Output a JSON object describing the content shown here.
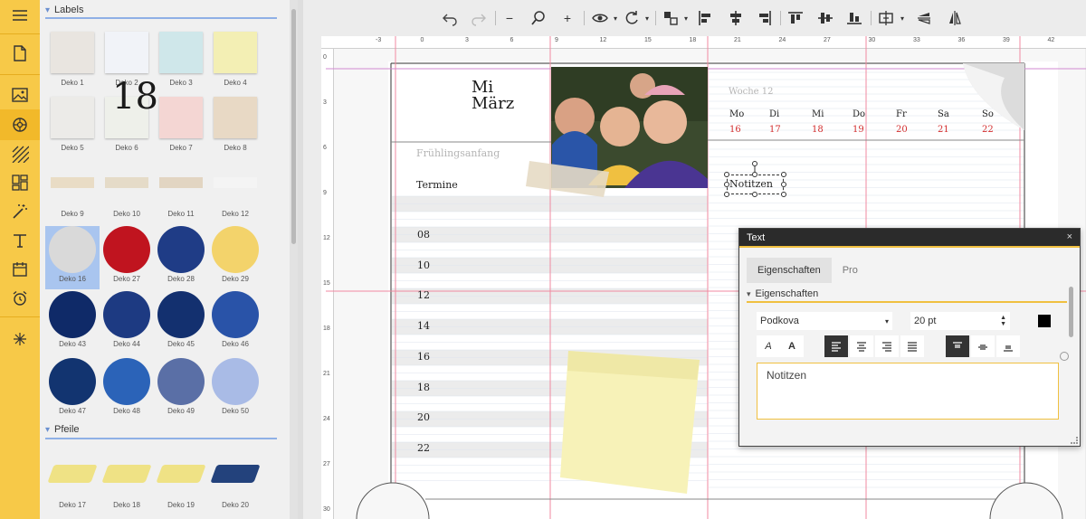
{
  "rail": {
    "items": [
      {
        "icon": "hamburger-menu-icon"
      },
      {
        "icon": "document-icon"
      },
      {
        "icon": "image-icon"
      },
      {
        "icon": "sticker-icon"
      },
      {
        "icon": "pattern-icon"
      },
      {
        "icon": "layout-icon"
      },
      {
        "icon": "magic-wand-icon"
      },
      {
        "icon": "text-icon"
      },
      {
        "icon": "calendar-icon"
      },
      {
        "icon": "alarm-clock-icon"
      },
      {
        "icon": "sparkle-icon"
      }
    ]
  },
  "library": {
    "section_labels": "Labels",
    "section_arrows": "Pfeile",
    "thumbs": [
      {
        "label": "Deko 1",
        "color": "#e9e5e0"
      },
      {
        "label": "Deko 2",
        "color": "#f1f3f8"
      },
      {
        "label": "Deko 3",
        "color": "#cfe7ea"
      },
      {
        "label": "Deko 4",
        "color": "#f3efb4"
      },
      {
        "label": "Deko 5",
        "color": "#ecebe8"
      },
      {
        "label": "Deko 6",
        "color": "#eef0ea"
      },
      {
        "label": "Deko 7",
        "color": "#f4d6d3"
      },
      {
        "label": "Deko 8",
        "color": "#e8d9c5"
      },
      {
        "label": "Deko 9",
        "color": "#e9dcc5"
      },
      {
        "label": "Deko 10",
        "color": "#e5dbc8"
      },
      {
        "label": "Deko 11",
        "color": "#e2d5c2"
      },
      {
        "label": "Deko 12",
        "color": "#f4f4f4"
      },
      {
        "label": "Deko 16",
        "color": "#d9d9d9"
      },
      {
        "label": "Deko 27",
        "color": "#c0141f"
      },
      {
        "label": "Deko 28",
        "color": "#1f3c86"
      },
      {
        "label": "Deko 29",
        "color": "#f3d36b"
      },
      {
        "label": "Deko 43",
        "color": "#0f2a68"
      },
      {
        "label": "Deko 44",
        "color": "#1d3a82"
      },
      {
        "label": "Deko 45",
        "color": "#13306f"
      },
      {
        "label": "Deko 46",
        "color": "#2953a8"
      },
      {
        "label": "Deko 47",
        "color": "#123470"
      },
      {
        "label": "Deko 48",
        "color": "#2b63b8"
      },
      {
        "label": "Deko 49",
        "color": "#5a6fa6"
      },
      {
        "label": "Deko 50",
        "color": "#a9bbe6"
      },
      {
        "label": "Deko 17",
        "color": "#efe285"
      },
      {
        "label": "Deko 18",
        "color": "#efe285"
      },
      {
        "label": "Deko 19",
        "color": "#efe285"
      },
      {
        "label": "Deko 20",
        "color": "#23427c"
      }
    ]
  },
  "ruler": {
    "top": [
      "-3",
      "0",
      "3",
      "6",
      "9",
      "12",
      "15",
      "18",
      "21",
      "24",
      "27",
      "30",
      "33",
      "36",
      "39",
      "42"
    ],
    "left": [
      "0",
      "3",
      "6",
      "9",
      "12",
      "15",
      "18",
      "21",
      "24",
      "27",
      "30"
    ]
  },
  "planner": {
    "day": "18",
    "weekday": "Mi",
    "month": "März",
    "event": "Frühlingsanfang",
    "termine": "Termine",
    "hours": [
      "08",
      "10",
      "12",
      "14",
      "16",
      "18",
      "20",
      "22"
    ],
    "week_label": "Woche 12",
    "weekdays": [
      "Mo",
      "Di",
      "Mi",
      "Do",
      "Fr",
      "Sa",
      "So"
    ],
    "week_dates": [
      "16",
      "17",
      "18",
      "19",
      "20",
      "21",
      "22"
    ],
    "notes_label": "Notitzen"
  },
  "text_panel": {
    "title": "Text",
    "close": "×",
    "tab_properties": "Eigenschaften",
    "tab_pro": "Pro",
    "section": "Eigenschaften",
    "font": "Podkova",
    "size": "20 pt",
    "italic": "A",
    "bold": "A",
    "text": "Notitzen"
  }
}
